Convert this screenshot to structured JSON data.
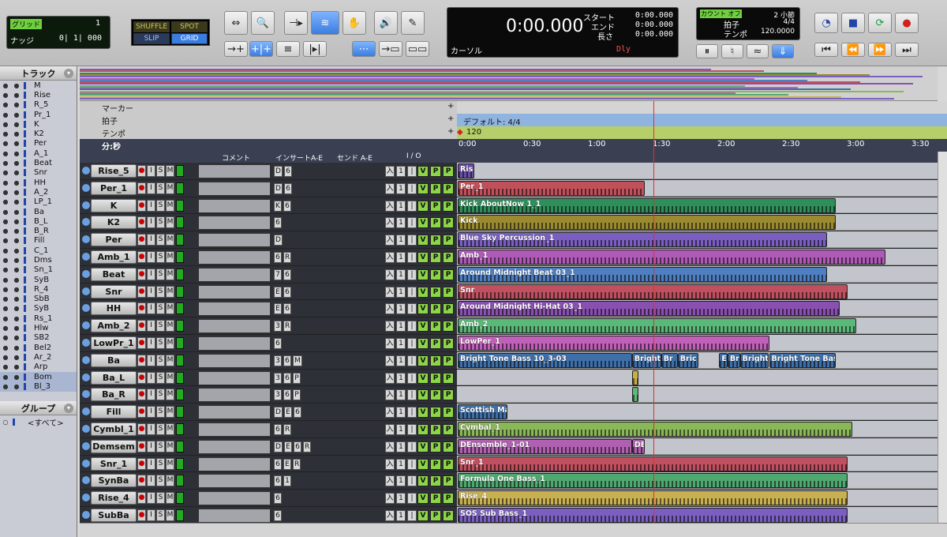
{
  "toolbar": {
    "grid_label": "グリッド",
    "grid_value": "1",
    "nudge_label": "ナッジ",
    "nudge_value": "0| 1| 000",
    "modes": [
      "SHUFFLE",
      "SPOT",
      "SLIP",
      "GRID"
    ],
    "counter": "0:00.000",
    "start_label": "スタート",
    "end_label": "エンド",
    "length_label": "長さ",
    "start": "0:00.000",
    "end": "0:00.000",
    "length": "0:00.000",
    "cursor_label": "カーソル",
    "dly": "Dly",
    "count_off": "カウント オフ",
    "bars": "2 小節",
    "meter_label": "拍子",
    "meter": "4/4",
    "tempo_label": "テンポ",
    "tempo": "120.0000"
  },
  "tracklist": {
    "title": "トラック",
    "items": [
      "M",
      "Rise",
      "R_5",
      "Pr_1",
      "K",
      "K2",
      "Per",
      "A_1",
      "Beat",
      "Snr",
      "HH",
      "A_2",
      "LP_1",
      "Ba",
      "B_L",
      "B_R",
      "Fill",
      "C_1",
      "Dms",
      "Sn_1",
      "SyB",
      "R_4",
      "SbB",
      "SyB",
      "Rs_1",
      "Hlw",
      "SB2",
      "Bel2",
      "Ar_2",
      "Arp",
      "Bom",
      "Bl_3"
    ]
  },
  "groups": {
    "title": "グループ",
    "all": "<すべて>"
  },
  "rulers": {
    "marker": "マーカー",
    "meter": "拍子",
    "tempo": "テンポ",
    "timescale": "分:秒",
    "meter_default": "デフォルト: 4/4",
    "tempo_value": "120"
  },
  "time_ticks": [
    "0:00",
    "0:30",
    "1:00",
    "1:30",
    "2:00",
    "2:30",
    "3:00",
    "3:30"
  ],
  "columns": {
    "comment": "コメント",
    "inserts": "インサートA-E",
    "sends": "センド A-E",
    "io": "I / O"
  },
  "tracks": [
    {
      "name": "Rise_5",
      "ins": [
        "D",
        "6"
      ],
      "clips": [
        {
          "label": "Rise",
          "color": "#6a4fa8",
          "start": 0.0,
          "end": 0.4
        }
      ]
    },
    {
      "name": "Per_1",
      "ins": [
        "D",
        "6"
      ],
      "clips": [
        {
          "label": "Per_1",
          "color": "#c0505a",
          "start": 0.0,
          "end": 4.5
        }
      ]
    },
    {
      "name": "K",
      "ins": [
        "K",
        "6"
      ],
      "clips": [
        {
          "label": "Kick AboutNow 1_1",
          "color": "#2f8f5a",
          "start": 0.0,
          "end": 9.1
        }
      ]
    },
    {
      "name": "K2",
      "ins": [
        "6"
      ],
      "clips": [
        {
          "label": "Kick",
          "color": "#9a8a30",
          "start": 0.0,
          "end": 9.1
        }
      ]
    },
    {
      "name": "Per",
      "ins": [
        "D"
      ],
      "clips": [
        {
          "label": "Blue Sky Percussion_1",
          "color": "#7a5fc0",
          "start": 0.0,
          "end": 8.9
        }
      ]
    },
    {
      "name": "Amb_1",
      "ins": [
        "6",
        "R"
      ],
      "clips": [
        {
          "label": "Amb_1",
          "color": "#b05ab8",
          "start": 0.0,
          "end": 10.3
        }
      ]
    },
    {
      "name": "Beat",
      "ins": [
        "7",
        "6"
      ],
      "clips": [
        {
          "label": "Around Midnight Beat 03_1",
          "color": "#4f7fc0",
          "start": 0.0,
          "end": 8.9
        }
      ]
    },
    {
      "name": "Snr",
      "ins": [
        "E",
        "6"
      ],
      "clips": [
        {
          "label": "Snr",
          "color": "#c05060",
          "start": 0.0,
          "end": 9.4
        }
      ]
    },
    {
      "name": "HH",
      "ins": [
        "E",
        "6"
      ],
      "clips": [
        {
          "label": "Around Midnight Hi-Hat 03_1",
          "color": "#8a50b0",
          "start": 0.0,
          "end": 9.2
        }
      ]
    },
    {
      "name": "Amb_2",
      "ins": [
        "3",
        "R"
      ],
      "clips": [
        {
          "label": "Amb_2",
          "color": "#5ab878",
          "start": 0.0,
          "end": 9.6
        }
      ]
    },
    {
      "name": "LowPr_1",
      "ins": [
        "6"
      ],
      "clips": [
        {
          "label": "LowPer_1",
          "color": "#c060b8",
          "start": 0.0,
          "end": 7.5
        }
      ]
    },
    {
      "name": "Ba",
      "ins": [
        "3",
        "6",
        "M"
      ],
      "clips": [
        {
          "label": "Bright Tone Bass 10_3-03",
          "color": "#3f6fa8",
          "start": 0.0,
          "end": 4.2
        },
        {
          "label": "Bright",
          "color": "#3f6fa8",
          "start": 4.2,
          "end": 4.9
        },
        {
          "label": "Br",
          "color": "#3f6fa8",
          "start": 4.9,
          "end": 5.3
        },
        {
          "label": "Bric",
          "color": "#3f6fa8",
          "start": 5.3,
          "end": 5.8
        },
        {
          "label": "E",
          "color": "#3f6fa8",
          "start": 6.3,
          "end": 6.5
        },
        {
          "label": "Br",
          "color": "#3f6fa8",
          "start": 6.5,
          "end": 6.8
        },
        {
          "label": "Bright",
          "color": "#3f6fa8",
          "start": 6.8,
          "end": 7.5
        },
        {
          "label": "Bright Tone Bass",
          "color": "#3f6fa8",
          "start": 7.5,
          "end": 9.1
        }
      ]
    },
    {
      "name": "Ba_L",
      "ins": [
        "3",
        "6",
        "P"
      ],
      "clips": [
        {
          "label": "",
          "color": "#c8b040",
          "start": 4.2,
          "end": 4.35
        }
      ]
    },
    {
      "name": "Ba_R",
      "ins": [
        "3",
        "6",
        "P"
      ],
      "clips": [
        {
          "label": "",
          "color": "#5ab878",
          "start": 4.2,
          "end": 4.35
        }
      ]
    },
    {
      "name": "Fill",
      "ins": [
        "D",
        "E",
        "6"
      ],
      "clips": [
        {
          "label": "Scottish Marc",
          "color": "#3f6fa8",
          "start": 0.0,
          "end": 1.2
        }
      ]
    },
    {
      "name": "Cymbl_1",
      "ins": [
        "6",
        "R"
      ],
      "clips": [
        {
          "label": "Cymbal_1",
          "color": "#8ab858",
          "start": 0.0,
          "end": 9.5
        }
      ]
    },
    {
      "name": "Demsem",
      "ins": [
        "D",
        "E",
        "6",
        "R"
      ],
      "clips": [
        {
          "label": "DEnsemble_1-01",
          "color": "#b060b0",
          "start": 0.0,
          "end": 4.2
        },
        {
          "label": "DEnse",
          "color": "#b060b0",
          "start": 4.2,
          "end": 4.5
        }
      ]
    },
    {
      "name": "Snr_1",
      "ins": [
        "6",
        "E",
        "R"
      ],
      "clips": [
        {
          "label": "Snr_1",
          "color": "#c05060",
          "start": 0.0,
          "end": 9.4
        }
      ]
    },
    {
      "name": "SynBa",
      "ins": [
        "6",
        "1"
      ],
      "clips": [
        {
          "label": "Formula One Bass_1",
          "color": "#4fa870",
          "start": 0.0,
          "end": 9.4
        }
      ]
    },
    {
      "name": "Rise_4",
      "ins": [
        "6"
      ],
      "clips": [
        {
          "label": "Rise_4",
          "color": "#c8b050",
          "start": 0.0,
          "end": 9.4
        }
      ]
    },
    {
      "name": "SubBa",
      "ins": [
        "6"
      ],
      "clips": [
        {
          "label": "SOS Sub Bass_1",
          "color": "#7a5fc0",
          "start": 0.0,
          "end": 9.4
        }
      ]
    }
  ]
}
